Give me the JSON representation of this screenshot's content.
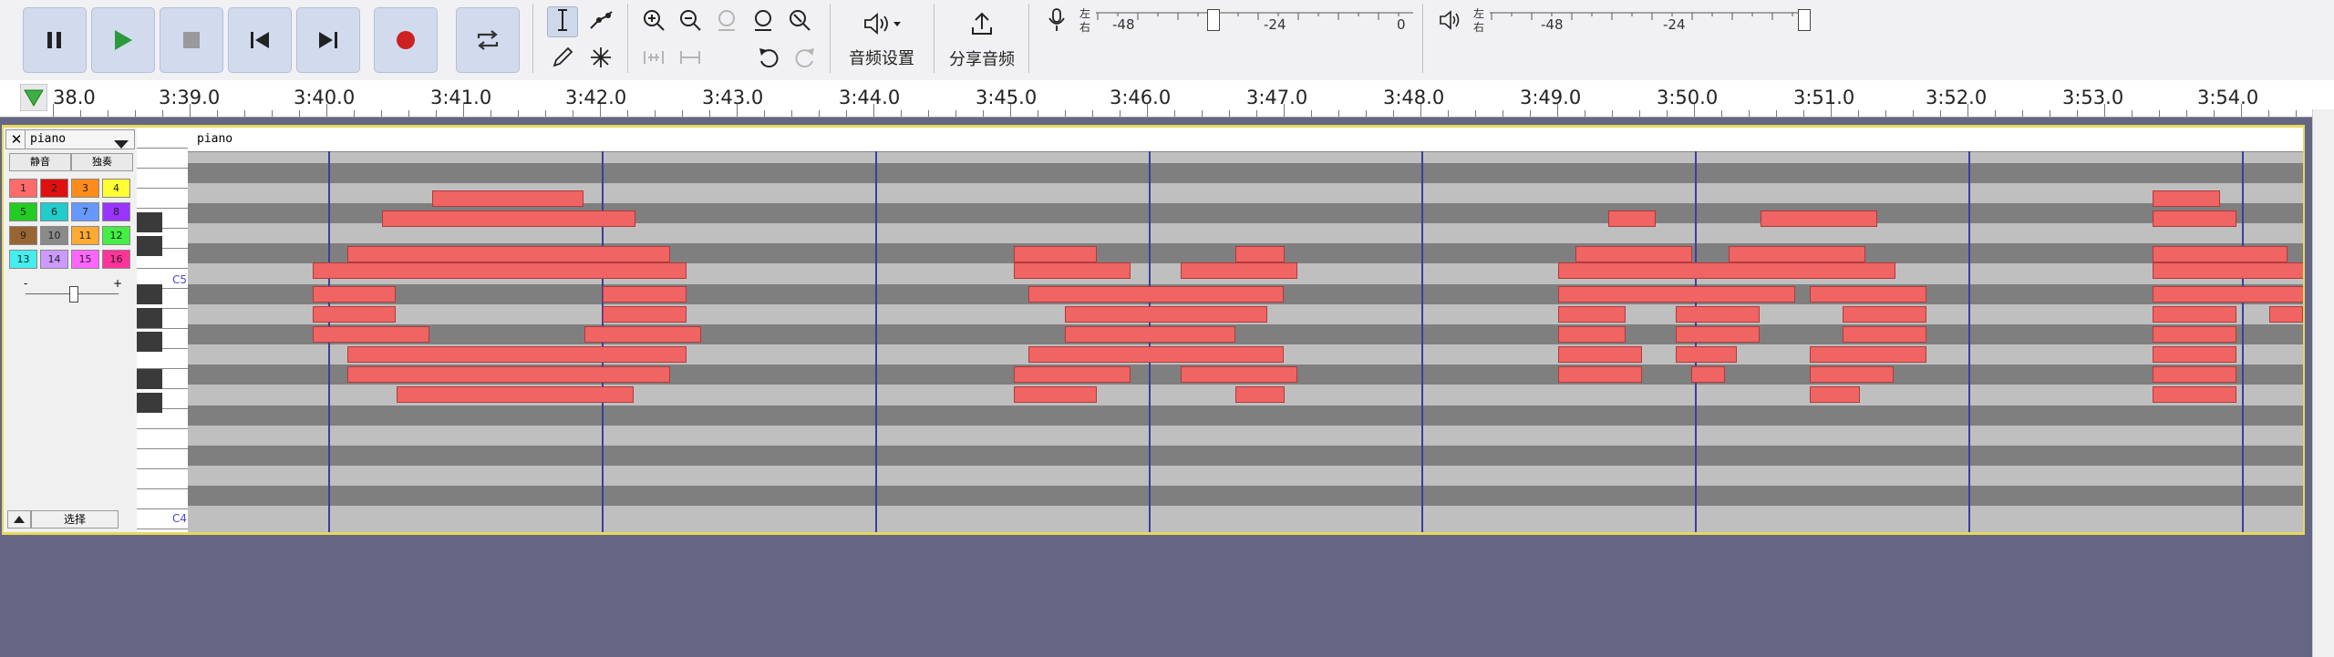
{
  "toolbar": {
    "audio_setup_label": "音频设置",
    "share_audio_label": "分享音频",
    "lr_top": "左",
    "lr_bottom": "右",
    "rec_meter_ticks": [
      "-48",
      "-24",
      "0"
    ],
    "play_meter_ticks": [
      "-48",
      "-24"
    ],
    "icons": [
      "pause-icon",
      "play-icon",
      "stop-icon",
      "skip-to-start-icon",
      "skip-to-end-icon",
      "record-icon",
      "loop-icon",
      "select-tool-icon",
      "envelope-tool-icon",
      "draw-tool-icon",
      "multi-tool-icon",
      "zoom-in-icon",
      "zoom-out-icon",
      "fit-selection-icon",
      "fit-project-icon",
      "zoom-toggle-icon",
      "trim-icon",
      "silence-icon",
      "undo-icon",
      "redo-icon",
      "speaker-icon",
      "upload-icon",
      "microphone-icon"
    ]
  },
  "ruler": {
    "labels": [
      "38.0",
      "3:39.0",
      "3:40.0",
      "3:41.0",
      "3:42.0",
      "3:43.0",
      "3:44.0",
      "3:45.0",
      "3:46.0",
      "3:47.0",
      "3:48.0",
      "3:49.0",
      "3:50.0",
      "3:51.0",
      "3:52.0",
      "3:53.0",
      "3:54.0"
    ]
  },
  "track": {
    "name": "piano",
    "clip_name": "piano",
    "mute_label": "静音",
    "solo_label": "独奏",
    "select_label": "选择",
    "channels": [
      "1",
      "2",
      "3",
      "4",
      "5",
      "6",
      "7",
      "8",
      "9",
      "10",
      "11",
      "12",
      "13",
      "14",
      "15",
      "16"
    ],
    "channel_colors": [
      "#ff6a6a",
      "#e01010",
      "#ff8c1a",
      "#ffff33",
      "#22cc22",
      "#22cccc",
      "#6699ff",
      "#9933ff",
      "#996633",
      "#8a8a8a",
      "#ffaa33",
      "#44ee44",
      "#44eeee",
      "#cc99ff",
      "#ff66ff",
      "#ff3399"
    ],
    "octave_labels": [
      "C5",
      "C4"
    ],
    "slider_minus": "-",
    "slider_plus": "+"
  },
  "colors": {
    "note": "#f06464",
    "selected_border": "#e6d85c",
    "background": "#646684",
    "accent": "#3d3d9e"
  }
}
